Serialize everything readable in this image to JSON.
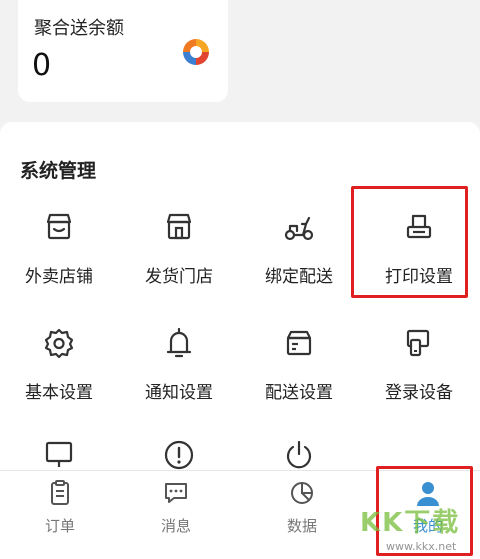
{
  "balance": {
    "title": "聚合送余额",
    "value": "0",
    "logo_icon": "aggregate-logo-icon"
  },
  "management": {
    "title": "系统管理",
    "items": [
      {
        "label": "外卖店铺",
        "icon": "store-icon"
      },
      {
        "label": "发货门店",
        "icon": "shop-icon"
      },
      {
        "label": "绑定配送",
        "icon": "scooter-icon"
      },
      {
        "label": "打印设置",
        "icon": "printer-icon"
      },
      {
        "label": "基本设置",
        "icon": "gear-icon"
      },
      {
        "label": "通知设置",
        "icon": "bell-icon"
      },
      {
        "label": "配送设置",
        "icon": "box-icon"
      },
      {
        "label": "登录设备",
        "icon": "devices-icon"
      },
      {
        "label": "",
        "icon": "monitor-icon"
      },
      {
        "label": "",
        "icon": "alert-icon"
      },
      {
        "label": "",
        "icon": "power-icon"
      }
    ]
  },
  "tabs": [
    {
      "label": "订单",
      "icon": "order-icon"
    },
    {
      "label": "消息",
      "icon": "message-icon"
    },
    {
      "label": "数据",
      "icon": "chart-icon"
    },
    {
      "label": "我的",
      "icon": "user-icon",
      "active": true
    }
  ],
  "watermark": {
    "text": "KK下载",
    "url": "www.kkx.net"
  },
  "colors": {
    "accent": "#3a8fd0",
    "highlight": "#e02020"
  }
}
